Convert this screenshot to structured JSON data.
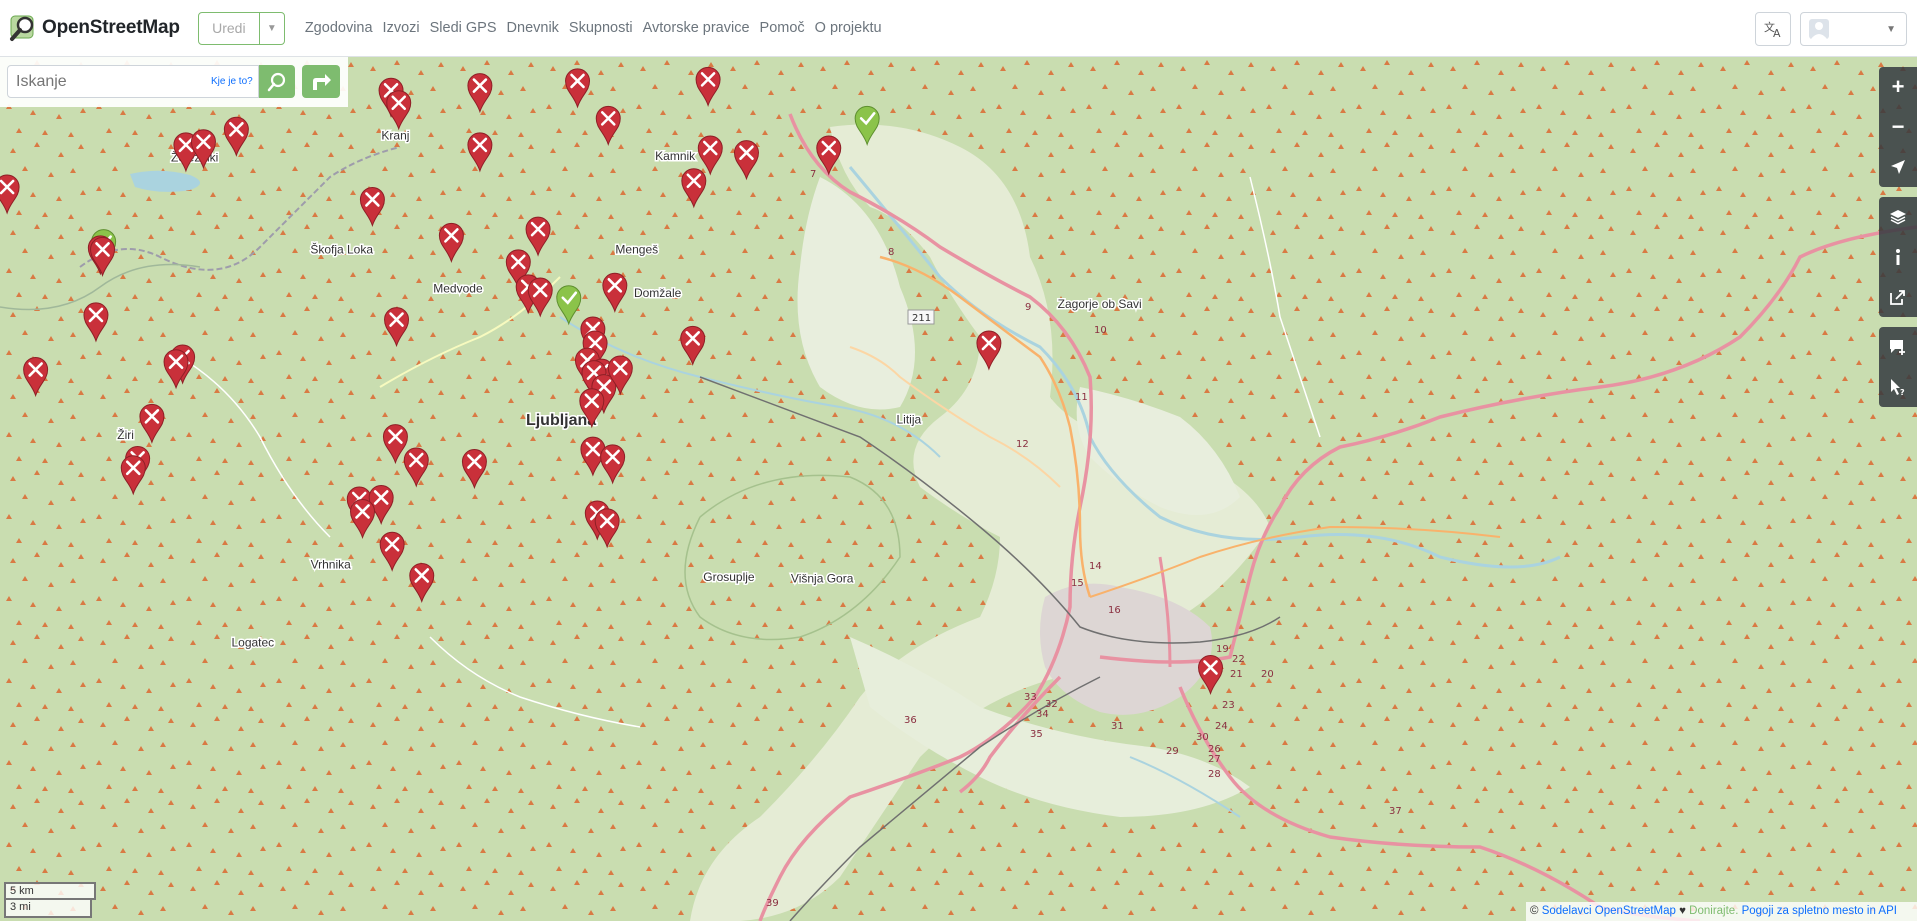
{
  "header": {
    "brand": "OpenStreetMap",
    "edit_label": "Uredi",
    "nav": [
      "Zgodovina",
      "Izvozi",
      "Sledi GPS",
      "Dnevnik",
      "Skupnosti",
      "Avtorske pravice",
      "Pomoč",
      "O projektu"
    ]
  },
  "search": {
    "placeholder": "Iskanje",
    "where_link": "Kje je to?"
  },
  "places": [
    {
      "name": "Kranj",
      "lon": 14.355,
      "lat": 46.239
    },
    {
      "name": "Železniki",
      "lon": 14.172,
      "lat": 46.225
    },
    {
      "name": "Škofja Loka",
      "lon": 14.306,
      "lat": 46.166
    },
    {
      "name": "Medvode",
      "lon": 14.412,
      "lat": 46.141
    },
    {
      "name": "Mengeš",
      "lon": 14.575,
      "lat": 46.166
    },
    {
      "name": "Domžale",
      "lon": 14.594,
      "lat": 46.138
    },
    {
      "name": "Zagorje ob Savi",
      "lon": 14.997,
      "lat": 46.131
    },
    {
      "name": "Litija",
      "lon": 14.823,
      "lat": 46.057
    },
    {
      "name": "Žiri",
      "lon": 14.109,
      "lat": 46.047
    },
    {
      "name": "Ljubljana",
      "lon": 14.506,
      "lat": 46.056
    },
    {
      "name": "Vrhnika",
      "lon": 14.296,
      "lat": 45.964
    },
    {
      "name": "Grosuplje",
      "lon": 14.659,
      "lat": 45.956
    },
    {
      "name": "Višnja Gora",
      "lon": 14.744,
      "lat": 45.955
    },
    {
      "name": "Logatec",
      "lon": 14.225,
      "lat": 45.914
    },
    {
      "name": "Kamnik",
      "lon": 14.61,
      "lat": 46.226
    }
  ],
  "road_refs": [
    "7",
    "8",
    "9",
    "10",
    "11",
    "12",
    "14",
    "15",
    "16",
    "19",
    "20",
    "21",
    "22",
    "23",
    "24",
    "26",
    "27",
    "28",
    "29",
    "30",
    "31",
    "32",
    "33",
    "34",
    "35",
    "36",
    "37",
    "39",
    "211"
  ],
  "notes": {
    "open_color": "#c9303a",
    "closed_color": "#8bc34a",
    "open": [
      [
        14.001,
        46.192
      ],
      [
        14.164,
        46.219
      ],
      [
        14.18,
        46.221
      ],
      [
        14.21,
        46.229
      ],
      [
        14.351,
        46.254
      ],
      [
        14.358,
        46.246
      ],
      [
        14.432,
        46.257
      ],
      [
        14.432,
        46.219
      ],
      [
        14.521,
        46.26
      ],
      [
        14.549,
        46.236
      ],
      [
        14.64,
        46.261
      ],
      [
        14.642,
        46.217
      ],
      [
        14.627,
        46.196
      ],
      [
        14.675,
        46.214
      ],
      [
        14.75,
        46.217
      ],
      [
        14.086,
        46.153
      ],
      [
        14.088,
        46.152
      ],
      [
        14.082,
        46.11
      ],
      [
        14.027,
        46.075
      ],
      [
        14.161,
        46.083
      ],
      [
        14.155,
        46.08
      ],
      [
        14.133,
        46.045
      ],
      [
        14.12,
        46.018
      ],
      [
        14.116,
        46.012
      ],
      [
        14.334,
        46.184
      ],
      [
        14.406,
        46.161
      ],
      [
        14.485,
        46.165
      ],
      [
        14.467,
        46.144
      ],
      [
        14.476,
        46.128
      ],
      [
        14.487,
        46.126
      ],
      [
        14.555,
        46.129
      ],
      [
        14.356,
        46.107
      ],
      [
        14.535,
        46.101
      ],
      [
        14.537,
        46.092
      ],
      [
        14.53,
        46.081
      ],
      [
        14.543,
        46.074
      ],
      [
        14.536,
        46.073
      ],
      [
        14.545,
        46.064
      ],
      [
        14.534,
        46.055
      ],
      [
        14.56,
        46.076
      ],
      [
        14.626,
        46.095
      ],
      [
        14.355,
        46.032
      ],
      [
        14.535,
        46.024
      ],
      [
        14.553,
        46.019
      ],
      [
        14.427,
        46.016
      ],
      [
        14.322,
        45.992
      ],
      [
        14.342,
        45.993
      ],
      [
        14.374,
        46.017
      ],
      [
        14.539,
        45.983
      ],
      [
        14.548,
        45.978
      ],
      [
        14.352,
        45.963
      ],
      [
        14.325,
        45.984
      ],
      [
        14.379,
        45.943
      ],
      [
        14.896,
        46.092
      ],
      [
        15.098,
        45.884
      ]
    ],
    "closed": [
      [
        14.089,
        46.157
      ],
      [
        14.513,
        46.121
      ],
      [
        14.785,
        46.236
      ]
    ]
  },
  "controls": {
    "zoom_in": "+",
    "zoom_out": "−"
  },
  "scale": {
    "km": "5 km",
    "mi": "3 mi"
  },
  "attribution": {
    "prefix": "©",
    "contributors": "Sodelavci OpenStreetMap",
    "heart": "♥",
    "donate": "Donirajte.",
    "terms": "Pogoji za spletno mesto in API"
  }
}
